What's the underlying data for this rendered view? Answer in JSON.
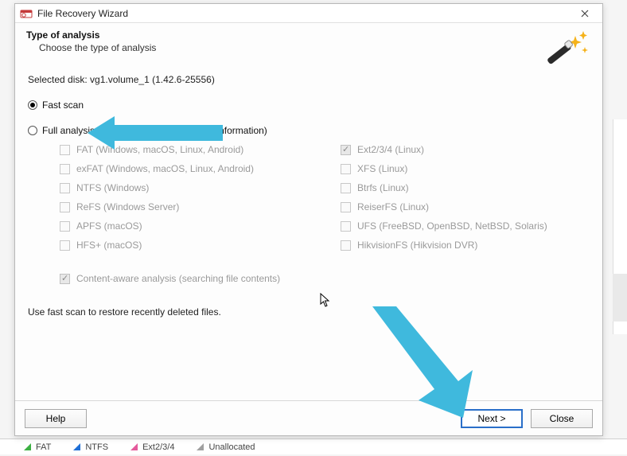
{
  "window": {
    "title": "File Recovery Wizard"
  },
  "header": {
    "title": "Type of analysis",
    "subtitle": "Choose the type of analysis"
  },
  "selected_disk_label": "Selected disk: vg1.volume_1 (1.42.6-25556)",
  "options": {
    "fast_scan": {
      "label": "Fast scan",
      "selected": true
    },
    "full_analysis": {
      "label": "Full analysis (searching for any available information)",
      "selected": false
    }
  },
  "filesystems_left": [
    {
      "label": "FAT (Windows, macOS, Linux, Android)",
      "checked": false
    },
    {
      "label": "exFAT (Windows, macOS, Linux, Android)",
      "checked": false
    },
    {
      "label": "NTFS (Windows)",
      "checked": false
    },
    {
      "label": "ReFS (Windows Server)",
      "checked": false
    },
    {
      "label": "APFS (macOS)",
      "checked": false
    },
    {
      "label": "HFS+ (macOS)",
      "checked": false
    }
  ],
  "filesystems_right": [
    {
      "label": "Ext2/3/4 (Linux)",
      "checked": true
    },
    {
      "label": "XFS (Linux)",
      "checked": false
    },
    {
      "label": "Btrfs (Linux)",
      "checked": false
    },
    {
      "label": "ReiserFS (Linux)",
      "checked": false
    },
    {
      "label": "UFS (FreeBSD, OpenBSD, NetBSD, Solaris)",
      "checked": false
    },
    {
      "label": "HikvisionFS (Hikvision DVR)",
      "checked": false
    }
  ],
  "content_aware": {
    "label": "Content-aware analysis (searching file contents)",
    "checked": true
  },
  "hint": "Use fast scan to restore recently deleted files.",
  "buttons": {
    "help": "Help",
    "next": "Next >",
    "close": "Close"
  },
  "statusbar": {
    "fat": "FAT",
    "ntfs": "NTFS",
    "ext": "Ext2/3/4",
    "unalloc": "Unallocated"
  },
  "colors": {
    "arrow": "#3fb9dd"
  }
}
